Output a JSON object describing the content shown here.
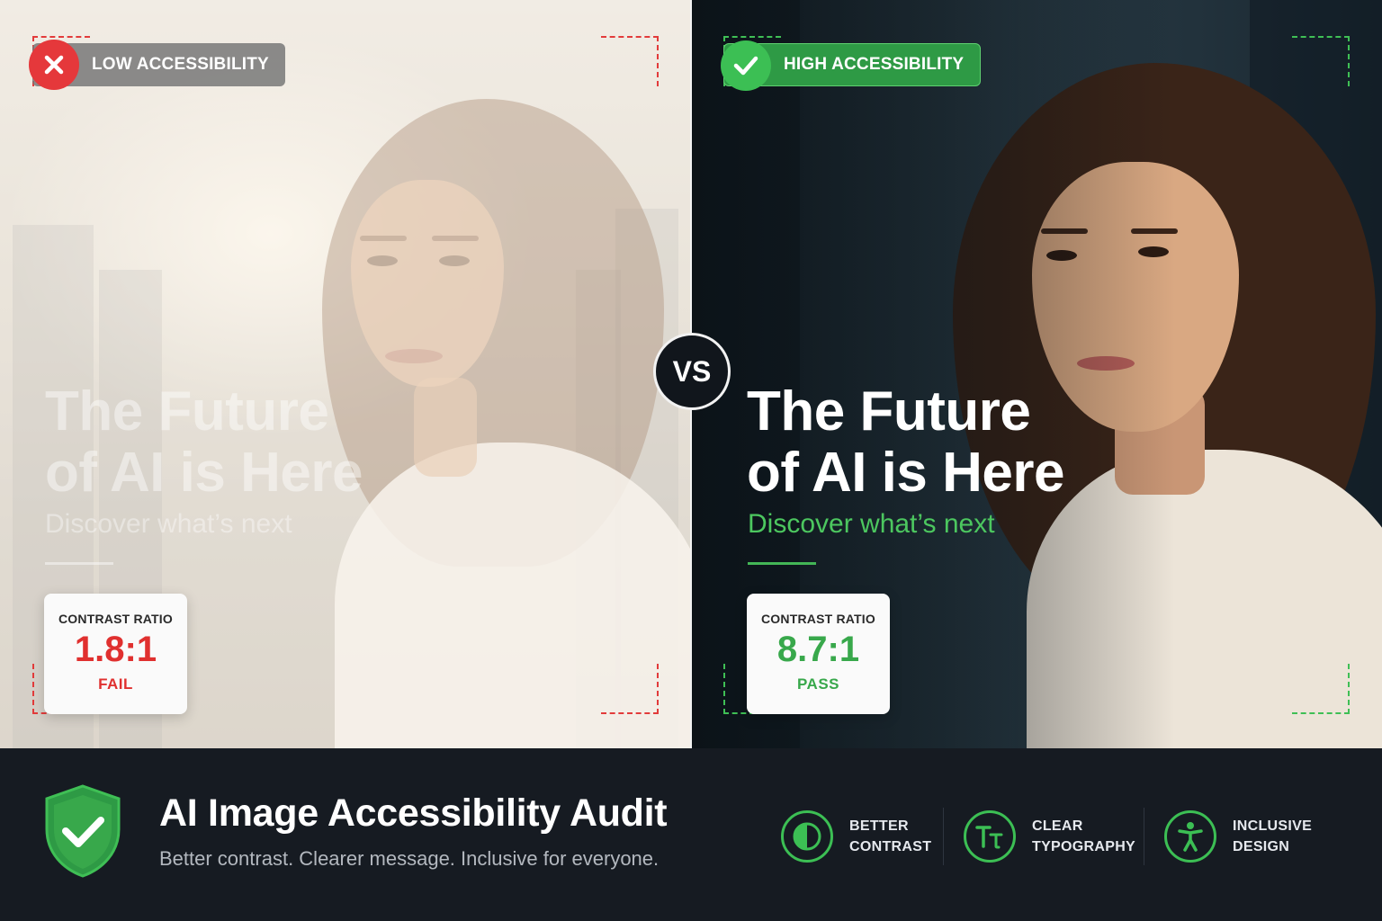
{
  "left_panel": {
    "badge_label": "LOW ACCESSIBILITY",
    "badge_icon": "x-icon",
    "headline_line1": "The Future",
    "headline_line2": "of AI is Here",
    "subheadline": "Discover what’s next",
    "card": {
      "title": "CONTRAST RATIO",
      "value": "1.8:1",
      "result": "FAIL"
    },
    "accent_color": "#e23b3b"
  },
  "right_panel": {
    "badge_label": "HIGH ACCESSIBILITY",
    "badge_icon": "check-icon",
    "headline_line1": "The Future",
    "headline_line2": "of AI is Here",
    "subheadline": "Discover what’s next",
    "card": {
      "title": "CONTRAST RATIO",
      "value": "8.7:1",
      "result": "PASS"
    },
    "accent_color": "#3cbf54"
  },
  "vs_label": "VS",
  "footer": {
    "logo_icon": "shield-check-icon",
    "title": "AI Image Accessibility Audit",
    "subtitle": "Better contrast. Clearer message. Inclusive for everyone.",
    "features": [
      {
        "icon": "contrast-icon",
        "line1": "BETTER",
        "line2": "CONTRAST"
      },
      {
        "icon": "typography-icon",
        "line1": "CLEAR",
        "line2": "TYPOGRAPHY"
      },
      {
        "icon": "accessibility-icon",
        "line1": "INCLUSIVE",
        "line2": "DESIGN"
      }
    ]
  }
}
